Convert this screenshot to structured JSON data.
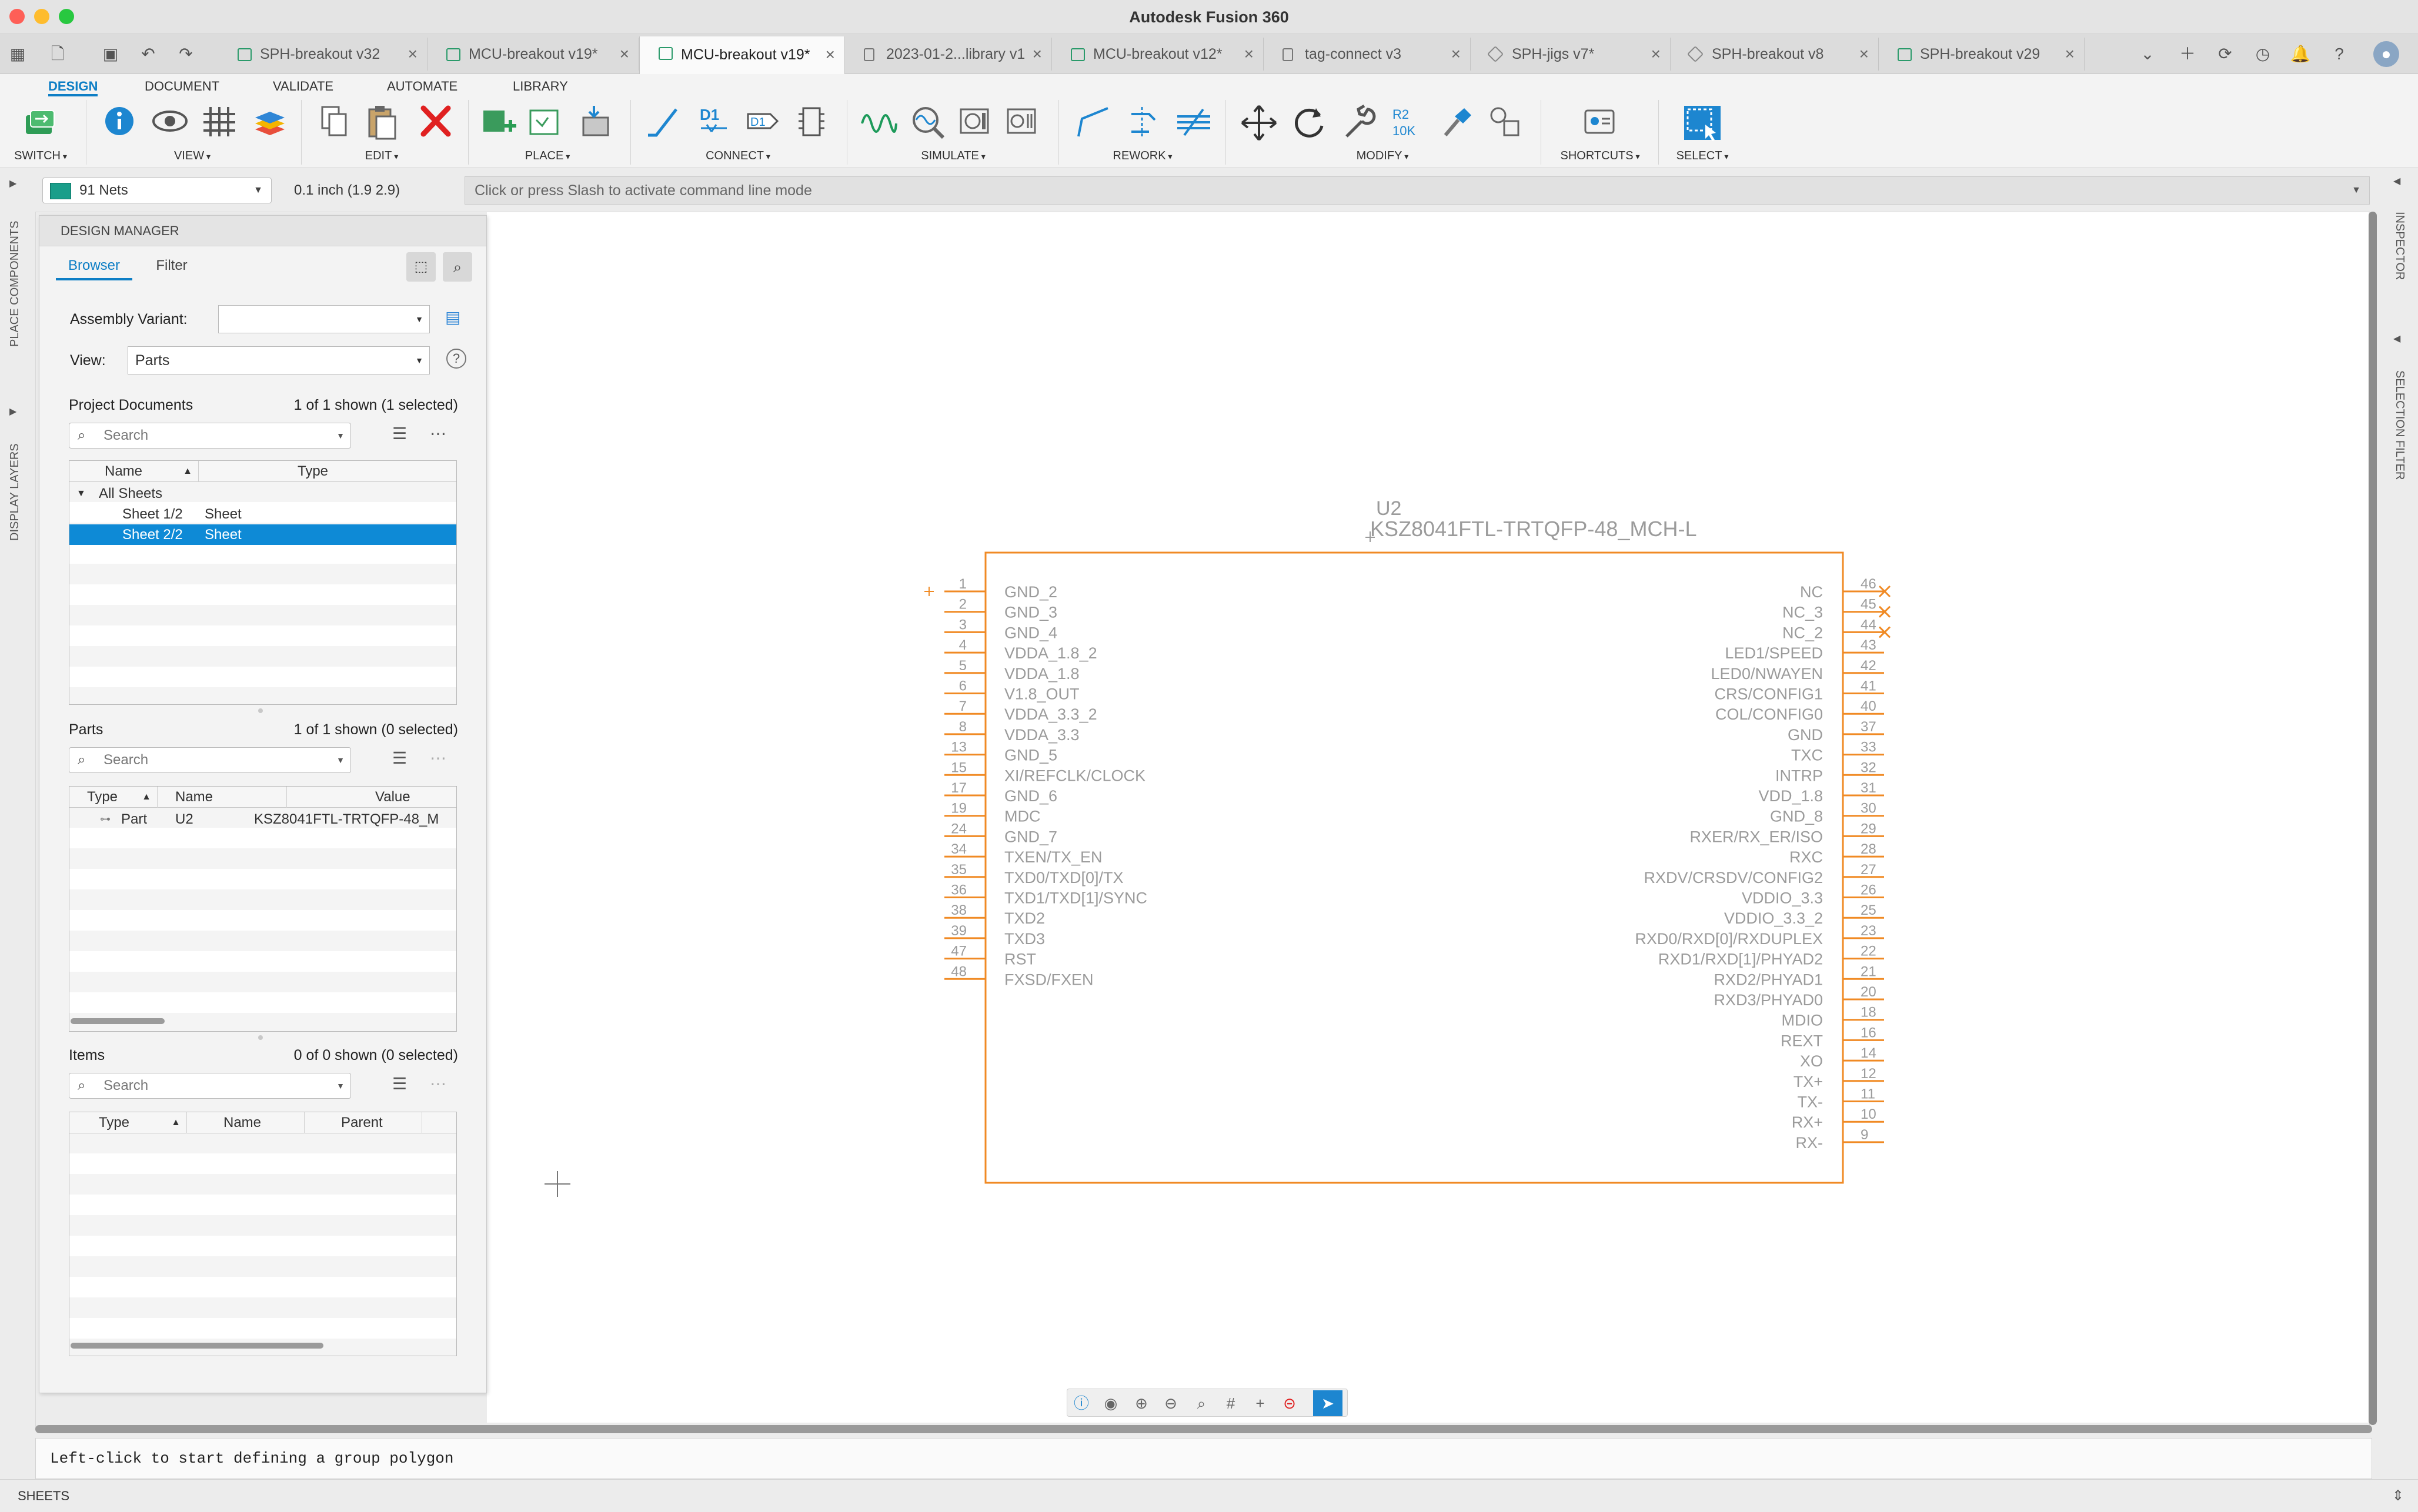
{
  "app": {
    "title": "Autodesk Fusion 360"
  },
  "tabs": [
    {
      "label": "SPH-breakout v32",
      "icon": "schematic"
    },
    {
      "label": "MCU-breakout v19*",
      "icon": "schematic"
    },
    {
      "label": "MCU-breakout v19*",
      "icon": "schematic",
      "active": true
    },
    {
      "label": "2023-01-2...library v1",
      "icon": "doc"
    },
    {
      "label": "MCU-breakout v12*",
      "icon": "schematic"
    },
    {
      "label": "tag-connect v3",
      "icon": "doc"
    },
    {
      "label": "SPH-jigs v7*",
      "icon": "cube"
    },
    {
      "label": "SPH-breakout v8",
      "icon": "cube"
    },
    {
      "label": "SPH-breakout v29",
      "icon": "schematic"
    }
  ],
  "ribbon": {
    "workspace_tabs": [
      "DESIGN",
      "DOCUMENT",
      "VALIDATE",
      "AUTOMATE",
      "LIBRARY"
    ],
    "groups": {
      "switch": "SWITCH",
      "view": "VIEW",
      "edit": "EDIT",
      "place": "PLACE",
      "connect": "CONNECT",
      "simulate": "SIMULATE",
      "rework": "REWORK",
      "modify": "MODIFY",
      "shortcuts": "SHORTCUTS",
      "select": "SELECT"
    },
    "connect_d1": "D1",
    "modify_r2": "R2",
    "modify_10k": "10K",
    "accent": "#0d7ec5"
  },
  "toolbar": {
    "nets": "91 Nets",
    "net_color": "#1a9e8a",
    "grid": "0.1 inch (1.9 2.9)",
    "command_placeholder": "Click or press Slash to activate command line mode"
  },
  "side": {
    "place_components": "PLACE COMPONENTS",
    "display_layers": "DISPLAY LAYERS",
    "inspector": "INSPECTOR",
    "selection_filter": "SELECTION FILTER"
  },
  "design_manager": {
    "title": "DESIGN MANAGER",
    "tabs": [
      "Browser",
      "Filter"
    ],
    "assembly_variant_label": "Assembly Variant:",
    "assembly_variant_value": "",
    "view_label": "View:",
    "view_value": "Parts",
    "search_placeholder": "Search",
    "project_documents": {
      "title": "Project Documents",
      "count": "1 of 1 shown (1 selected)",
      "columns": [
        "Name",
        "Type"
      ],
      "rows": [
        {
          "name": "All Sheets",
          "type": "",
          "expanded": true
        },
        {
          "name": "Sheet 1/2",
          "type": "Sheet"
        },
        {
          "name": "Sheet 2/2",
          "type": "Sheet",
          "selected": true
        }
      ]
    },
    "parts": {
      "title": "Parts",
      "count": "1 of 1 shown (0 selected)",
      "columns": [
        "Type",
        "Name",
        "Value"
      ],
      "rows": [
        {
          "type": "Part",
          "name": "U2",
          "value": "KSZ8041FTL-TRTQFP-48_M"
        }
      ]
    },
    "items": {
      "title": "Items",
      "count": "0 of 0 shown (0 selected)",
      "columns": [
        "Type",
        "Name",
        "Parent"
      ],
      "rows": []
    }
  },
  "schematic": {
    "part": {
      "name": "U2",
      "value": "KSZ8041FTL-TRTQFP-48_MCH-L",
      "color": "#f08a24"
    },
    "left_pins": [
      {
        "num": "1",
        "name": "GND_2"
      },
      {
        "num": "2",
        "name": "GND_3"
      },
      {
        "num": "3",
        "name": "GND_4"
      },
      {
        "num": "4",
        "name": "VDDA_1.8_2"
      },
      {
        "num": "5",
        "name": "VDDA_1.8"
      },
      {
        "num": "6",
        "name": "V1.8_OUT"
      },
      {
        "num": "7",
        "name": "VDDA_3.3_2"
      },
      {
        "num": "8",
        "name": "VDDA_3.3"
      },
      {
        "num": "13",
        "name": "GND_5"
      },
      {
        "num": "15",
        "name": "XI/REFCLK/CLOCK"
      },
      {
        "num": "17",
        "name": "GND_6"
      },
      {
        "num": "19",
        "name": "MDC"
      },
      {
        "num": "24",
        "name": "GND_7"
      },
      {
        "num": "34",
        "name": "TXEN/TX_EN"
      },
      {
        "num": "35",
        "name": "TXD0/TXD[0]/TX"
      },
      {
        "num": "36",
        "name": "TXD1/TXD[1]/SYNC"
      },
      {
        "num": "38",
        "name": "TXD2"
      },
      {
        "num": "39",
        "name": "TXD3"
      },
      {
        "num": "47",
        "name": "RST"
      },
      {
        "num": "48",
        "name": "FXSD/FXEN"
      }
    ],
    "right_pins": [
      {
        "num": "46",
        "name": "NC"
      },
      {
        "num": "45",
        "name": "NC_3"
      },
      {
        "num": "44",
        "name": "NC_2"
      },
      {
        "num": "43",
        "name": "LED1/SPEED"
      },
      {
        "num": "42",
        "name": "LED0/NWAYEN"
      },
      {
        "num": "41",
        "name": "CRS/CONFIG1"
      },
      {
        "num": "40",
        "name": "COL/CONFIG0"
      },
      {
        "num": "37",
        "name": "GND"
      },
      {
        "num": "33",
        "name": "TXC"
      },
      {
        "num": "32",
        "name": "INTRP"
      },
      {
        "num": "31",
        "name": "VDD_1.8"
      },
      {
        "num": "30",
        "name": "GND_8"
      },
      {
        "num": "29",
        "name": "RXER/RX_ER/ISO"
      },
      {
        "num": "28",
        "name": "RXC"
      },
      {
        "num": "27",
        "name": "RXDV/CRSDV/CONFIG2"
      },
      {
        "num": "26",
        "name": "VDDIO_3.3"
      },
      {
        "num": "25",
        "name": "VDDIO_3.3_2"
      },
      {
        "num": "23",
        "name": "RXD0/RXD[0]/RXDUPLEX"
      },
      {
        "num": "22",
        "name": "RXD1/RXD[1]/PHYAD2"
      },
      {
        "num": "21",
        "name": "RXD2/PHYAD1"
      },
      {
        "num": "20",
        "name": "RXD3/PHYAD0"
      },
      {
        "num": "18",
        "name": "MDIO"
      },
      {
        "num": "16",
        "name": "REXT"
      },
      {
        "num": "14",
        "name": "XO"
      },
      {
        "num": "12",
        "name": "TX+"
      },
      {
        "num": "11",
        "name": "TX-"
      },
      {
        "num": "10",
        "name": "RX+"
      },
      {
        "num": "9",
        "name": "RX-"
      }
    ]
  },
  "status": {
    "message": "Left-click to start defining a group polygon",
    "sheets": "SHEETS"
  }
}
